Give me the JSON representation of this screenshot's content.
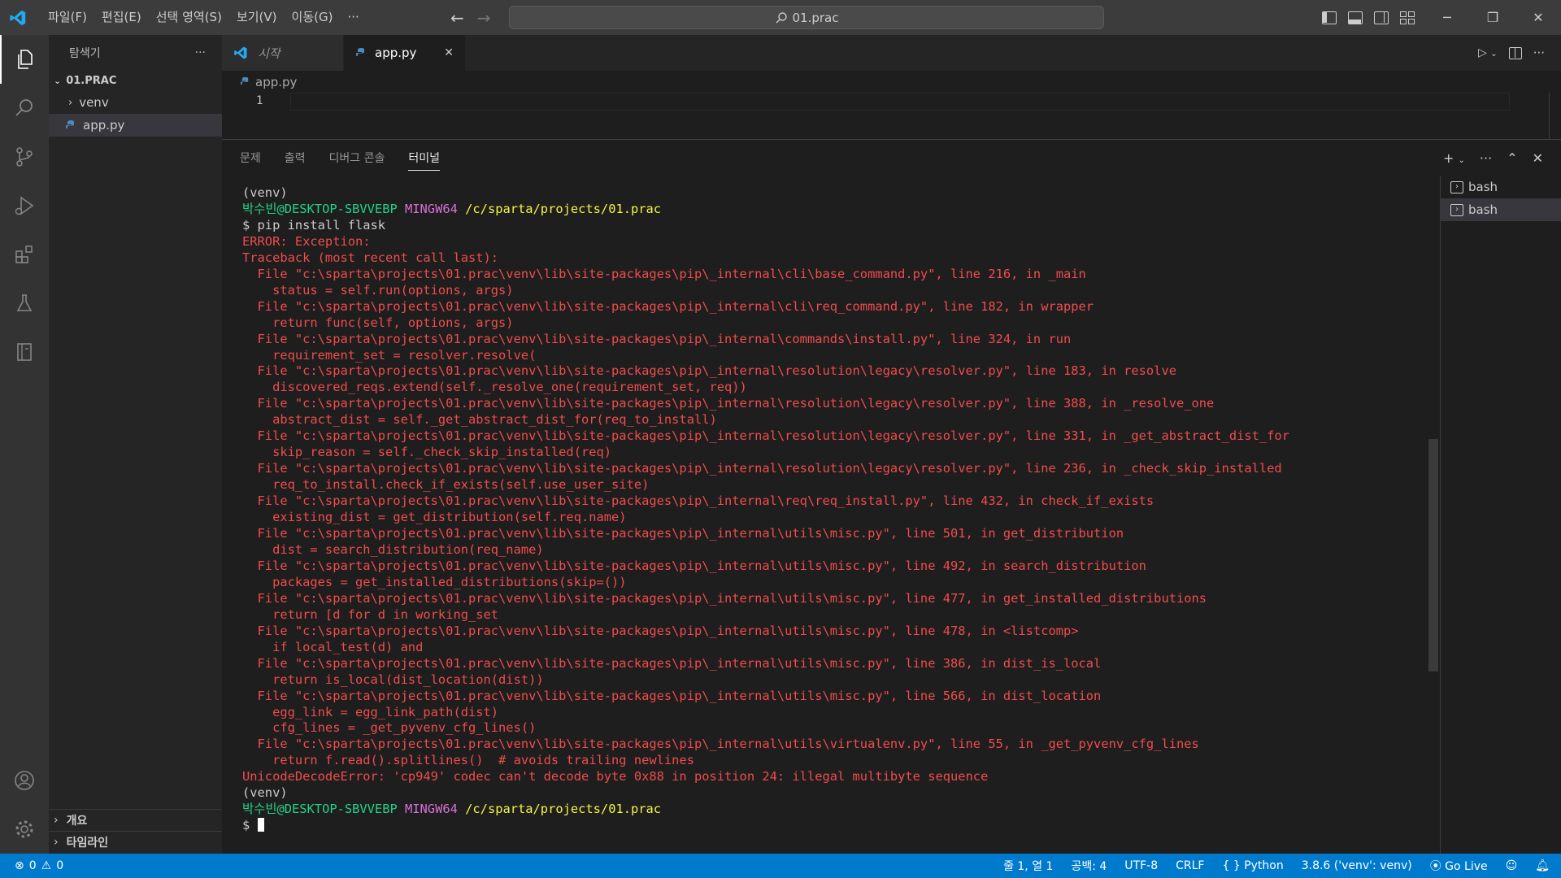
{
  "titlebar": {
    "menu": [
      "파일(F)",
      "편집(E)",
      "선택 영역(S)",
      "보기(V)",
      "이동(G)",
      "···"
    ],
    "search_text": "01.prac"
  },
  "sidebar": {
    "title": "탐색기",
    "more": "···",
    "root": "01.PRAC",
    "items": [
      {
        "label": "venv",
        "type": "folder"
      },
      {
        "label": "app.py",
        "type": "python-file"
      }
    ],
    "outline": "개요",
    "timeline": "타임라인"
  },
  "tabs": [
    {
      "label": "시작",
      "active": false
    },
    {
      "label": "app.py",
      "active": true
    }
  ],
  "breadcrumb": "app.py",
  "editor": {
    "line_number": "1"
  },
  "panel": {
    "tabs": [
      "문제",
      "출력",
      "디버그 콘솔",
      "터미널"
    ],
    "active_tab": "터미널",
    "terminals": [
      "bash",
      "bash"
    ]
  },
  "terminal_lines": [
    {
      "segs": [
        {
          "c": "t-white",
          "t": "(venv)"
        }
      ]
    },
    {
      "segs": [
        {
          "c": "t-green",
          "t": "박수빈@DESKTOP-SBVVEBP "
        },
        {
          "c": "t-mag",
          "t": "MINGW64 "
        },
        {
          "c": "t-yel",
          "t": "/c/sparta/projects/01.prac"
        }
      ]
    },
    {
      "segs": [
        {
          "c": "t-white",
          "t": "$ pip install flask"
        }
      ]
    },
    {
      "segs": [
        {
          "c": "t-err",
          "t": "ERROR: Exception:"
        }
      ]
    },
    {
      "segs": [
        {
          "c": "t-err",
          "t": "Traceback (most recent call last):"
        }
      ]
    },
    {
      "segs": [
        {
          "c": "t-err",
          "t": "  File \"c:\\sparta\\projects\\01.prac\\venv\\lib\\site-packages\\pip\\_internal\\cli\\base_command.py\", line 216, in _main"
        }
      ]
    },
    {
      "segs": [
        {
          "c": "t-err",
          "t": "    status = self.run(options, args)"
        }
      ]
    },
    {
      "segs": [
        {
          "c": "t-err",
          "t": "  File \"c:\\sparta\\projects\\01.prac\\venv\\lib\\site-packages\\pip\\_internal\\cli\\req_command.py\", line 182, in wrapper"
        }
      ]
    },
    {
      "segs": [
        {
          "c": "t-err",
          "t": "    return func(self, options, args)"
        }
      ]
    },
    {
      "segs": [
        {
          "c": "t-err",
          "t": "  File \"c:\\sparta\\projects\\01.prac\\venv\\lib\\site-packages\\pip\\_internal\\commands\\install.py\", line 324, in run"
        }
      ]
    },
    {
      "segs": [
        {
          "c": "t-err",
          "t": "    requirement_set = resolver.resolve("
        }
      ]
    },
    {
      "segs": [
        {
          "c": "t-err",
          "t": "  File \"c:\\sparta\\projects\\01.prac\\venv\\lib\\site-packages\\pip\\_internal\\resolution\\legacy\\resolver.py\", line 183, in resolve"
        }
      ]
    },
    {
      "segs": [
        {
          "c": "t-err",
          "t": "    discovered_reqs.extend(self._resolve_one(requirement_set, req))"
        }
      ]
    },
    {
      "segs": [
        {
          "c": "t-err",
          "t": "  File \"c:\\sparta\\projects\\01.prac\\venv\\lib\\site-packages\\pip\\_internal\\resolution\\legacy\\resolver.py\", line 388, in _resolve_one"
        }
      ]
    },
    {
      "segs": [
        {
          "c": "t-err",
          "t": "    abstract_dist = self._get_abstract_dist_for(req_to_install)"
        }
      ]
    },
    {
      "segs": [
        {
          "c": "t-err",
          "t": "  File \"c:\\sparta\\projects\\01.prac\\venv\\lib\\site-packages\\pip\\_internal\\resolution\\legacy\\resolver.py\", line 331, in _get_abstract_dist_for"
        }
      ]
    },
    {
      "segs": [
        {
          "c": "t-err",
          "t": "    skip_reason = self._check_skip_installed(req)"
        }
      ]
    },
    {
      "segs": [
        {
          "c": "t-err",
          "t": "  File \"c:\\sparta\\projects\\01.prac\\venv\\lib\\site-packages\\pip\\_internal\\resolution\\legacy\\resolver.py\", line 236, in _check_skip_installed"
        }
      ]
    },
    {
      "segs": [
        {
          "c": "t-err",
          "t": "    req_to_install.check_if_exists(self.use_user_site)"
        }
      ]
    },
    {
      "segs": [
        {
          "c": "t-err",
          "t": "  File \"c:\\sparta\\projects\\01.prac\\venv\\lib\\site-packages\\pip\\_internal\\req\\req_install.py\", line 432, in check_if_exists"
        }
      ]
    },
    {
      "segs": [
        {
          "c": "t-err",
          "t": "    existing_dist = get_distribution(self.req.name)"
        }
      ]
    },
    {
      "segs": [
        {
          "c": "t-err",
          "t": "  File \"c:\\sparta\\projects\\01.prac\\venv\\lib\\site-packages\\pip\\_internal\\utils\\misc.py\", line 501, in get_distribution"
        }
      ]
    },
    {
      "segs": [
        {
          "c": "t-err",
          "t": "    dist = search_distribution(req_name)"
        }
      ]
    },
    {
      "segs": [
        {
          "c": "t-err",
          "t": "  File \"c:\\sparta\\projects\\01.prac\\venv\\lib\\site-packages\\pip\\_internal\\utils\\misc.py\", line 492, in search_distribution"
        }
      ]
    },
    {
      "segs": [
        {
          "c": "t-err",
          "t": "    packages = get_installed_distributions(skip=())"
        }
      ]
    },
    {
      "segs": [
        {
          "c": "t-err",
          "t": "  File \"c:\\sparta\\projects\\01.prac\\venv\\lib\\site-packages\\pip\\_internal\\utils\\misc.py\", line 477, in get_installed_distributions"
        }
      ]
    },
    {
      "segs": [
        {
          "c": "t-err",
          "t": "    return [d for d in working_set"
        }
      ]
    },
    {
      "segs": [
        {
          "c": "t-err",
          "t": "  File \"c:\\sparta\\projects\\01.prac\\venv\\lib\\site-packages\\pip\\_internal\\utils\\misc.py\", line 478, in <listcomp>"
        }
      ]
    },
    {
      "segs": [
        {
          "c": "t-err",
          "t": "    if local_test(d) and"
        }
      ]
    },
    {
      "segs": [
        {
          "c": "t-err",
          "t": "  File \"c:\\sparta\\projects\\01.prac\\venv\\lib\\site-packages\\pip\\_internal\\utils\\misc.py\", line 386, in dist_is_local"
        }
      ]
    },
    {
      "segs": [
        {
          "c": "t-err",
          "t": "    return is_local(dist_location(dist))"
        }
      ]
    },
    {
      "segs": [
        {
          "c": "t-err",
          "t": "  File \"c:\\sparta\\projects\\01.prac\\venv\\lib\\site-packages\\pip\\_internal\\utils\\misc.py\", line 566, in dist_location"
        }
      ]
    },
    {
      "segs": [
        {
          "c": "t-err",
          "t": "    egg_link = egg_link_path(dist)"
        }
      ]
    },
    {
      "segs": [
        {
          "c": "t-err",
          "t": "    cfg_lines = _get_pyvenv_cfg_lines()"
        }
      ]
    },
    {
      "segs": [
        {
          "c": "t-err",
          "t": "  File \"c:\\sparta\\projects\\01.prac\\venv\\lib\\site-packages\\pip\\_internal\\utils\\virtualenv.py\", line 55, in _get_pyvenv_cfg_lines"
        }
      ]
    },
    {
      "segs": [
        {
          "c": "t-err",
          "t": "    return f.read().splitlines()  # avoids trailing newlines"
        }
      ]
    },
    {
      "segs": [
        {
          "c": "t-err",
          "t": "UnicodeDecodeError: 'cp949' codec can't decode byte 0x88 in position 24: illegal multibyte sequence"
        }
      ]
    },
    {
      "segs": [
        {
          "c": "t-white",
          "t": "(venv)"
        }
      ]
    },
    {
      "segs": [
        {
          "c": "t-green",
          "t": "박수빈@DESKTOP-SBVVEBP "
        },
        {
          "c": "t-mag",
          "t": "MINGW64 "
        },
        {
          "c": "t-yel",
          "t": "/c/sparta/projects/01.prac"
        }
      ]
    },
    {
      "segs": [
        {
          "c": "t-white",
          "t": "$ "
        }
      ],
      "cursor": true
    }
  ],
  "statusbar": {
    "errors": "0",
    "warnings": "0",
    "cursor_pos": "줄 1, 열 1",
    "spaces": "공백: 4",
    "encoding": "UTF-8",
    "eol": "CRLF",
    "language": "Python",
    "interpreter": "3.8.6 ('venv': venv)",
    "golive": "Go Live"
  },
  "colors": {
    "accent": "#007acc",
    "error": "#f14c4c",
    "prompt_user": "#23d18b",
    "prompt_host": "#d670d6",
    "prompt_path": "#f5f543"
  }
}
